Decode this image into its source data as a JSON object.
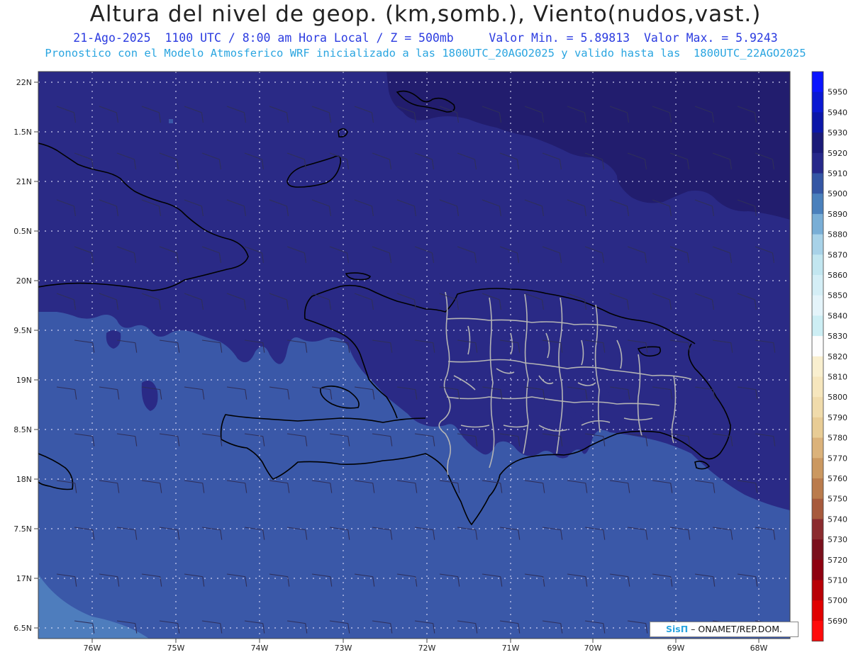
{
  "header": {
    "title": "Altura del nivel de geop. (km,somb.), Viento(nudos,vast.)",
    "date": "21-Ago-2025",
    "time": "1100 UTC / 8:00 am Hora Local / Z = 500mb",
    "min_label": "Valor Min. = 5.89813",
    "max_label": "Valor Max. = 5.9243",
    "forecast": "Pronostico con el Modelo Atmosferico WRF inicializado a las 1800UTC_20AGO2025 y valido hasta las  1800UTC_22AGO2025"
  },
  "map": {
    "lat_labels": [
      "22N",
      "1.5N",
      "21N",
      "0.5N",
      "20N",
      "9.5N",
      "19N",
      "8.5N",
      "18N",
      "7.5N",
      "17N",
      "6.5N"
    ],
    "lon_labels": [
      "76W",
      "75W",
      "74W",
      "73W",
      "72W",
      "71W",
      "70W",
      "69W",
      "68W"
    ],
    "field_colors": {
      "v5920": "#221d6e",
      "v5910": "#2a2a86",
      "v5900": "#3a58a8",
      "v5890": "#4e7dbd"
    },
    "coast_color": "#000000",
    "province_color": "#b4b4b4"
  },
  "colorbar": {
    "labels": [
      "5950",
      "5940",
      "5930",
      "5920",
      "5910",
      "5900",
      "5890",
      "5880",
      "5870",
      "5860",
      "5850",
      "5840",
      "5830",
      "5820",
      "5810",
      "5800",
      "5790",
      "5780",
      "5770",
      "5760",
      "5750",
      "5740",
      "5730",
      "5720",
      "5710",
      "5700",
      "5690"
    ],
    "colors": [
      "#0a14ff",
      "#0a18d2",
      "#0b16a8",
      "#1a1a78",
      "#26288a",
      "#3456a4",
      "#4a80bc",
      "#79aed6",
      "#a8d2e8",
      "#c2e6f0",
      "#d4eef6",
      "#e4f4fa",
      "#cdeef4",
      "#fdfdfd",
      "#f9efcf",
      "#f6e6bd",
      "#f0dbab",
      "#e8cc95",
      "#dbb27a",
      "#cb9860",
      "#ba7b4c",
      "#a75a3c",
      "#8b2b2e",
      "#7a0f1c",
      "#8e0010",
      "#b80006",
      "#e00000",
      "#ff0b0b"
    ]
  },
  "credit": {
    "logo": "SisΠ",
    "text": "– ONAMET/REP.DOM."
  }
}
